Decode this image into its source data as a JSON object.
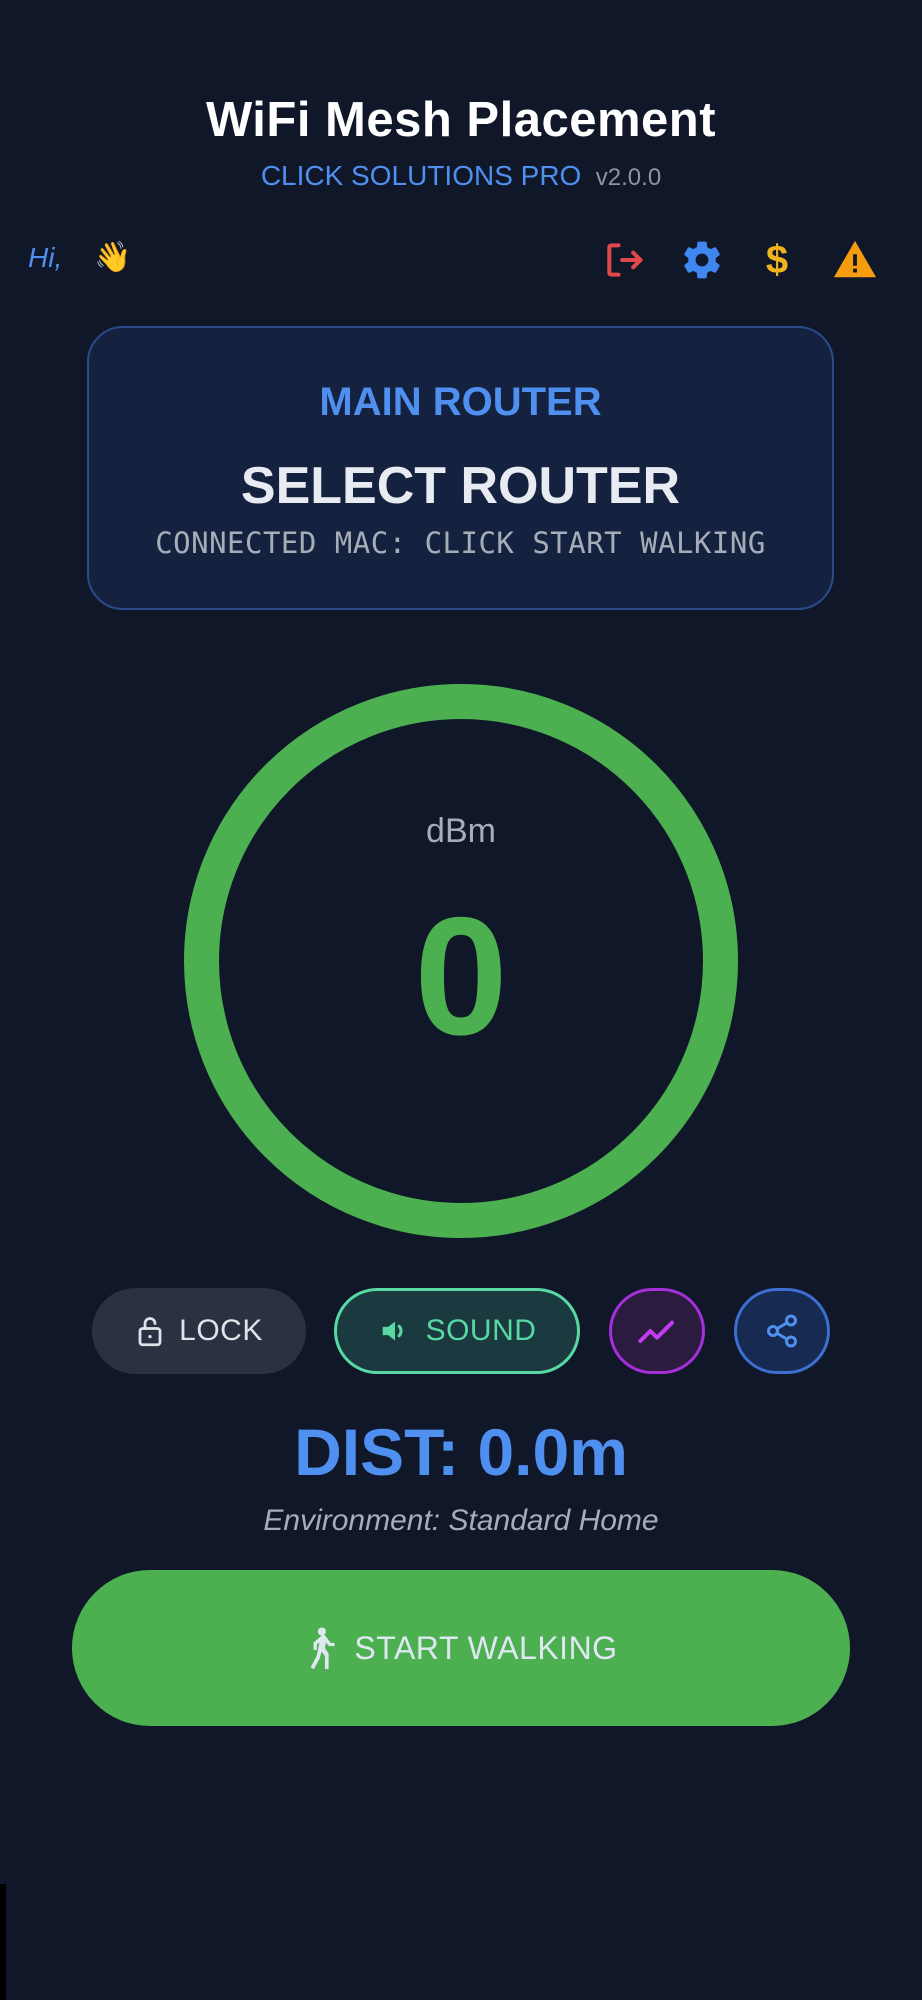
{
  "header": {
    "title": "WiFi Mesh Placement",
    "company": "CLICK SOLUTIONS PRO",
    "version": "v2.0.0"
  },
  "greeting": {
    "text": "Hi,",
    "icon": "waving-hand-icon"
  },
  "toolbar": {
    "icons": [
      {
        "name": "logout-icon",
        "color": "#e2474a"
      },
      {
        "name": "gear-icon",
        "color": "#3f86f0"
      },
      {
        "name": "dollar-icon",
        "color": "#f1b31c"
      },
      {
        "name": "warning-icon",
        "color": "#f59d0c"
      }
    ]
  },
  "router_card": {
    "label": "MAIN ROUTER",
    "name": "SELECT ROUTER",
    "mac_line": "CONNECTED MAC: CLICK START WALKING"
  },
  "signal": {
    "unit": "dBm",
    "value": "0",
    "ring_color": "#4cb050"
  },
  "controls": {
    "lock_label": "LOCK",
    "sound_label": "SOUND",
    "chart_icon": "trend-chart-icon",
    "share_icon": "share-icon"
  },
  "distance": {
    "text": "DIST: 0.0m",
    "environment": "Environment: Standard Home"
  },
  "start_button": {
    "label": "START WALKING",
    "icon": "walking-person-icon"
  },
  "colors": {
    "background": "#0f1729",
    "accent_blue": "#4f8ff0",
    "signal_green": "#4cb050",
    "sound_teal": "#58d9a4",
    "chart_purple": "#a52fd9"
  }
}
